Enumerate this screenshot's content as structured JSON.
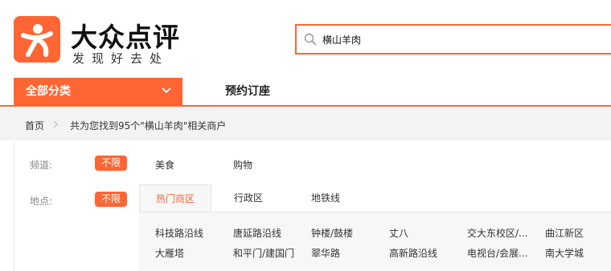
{
  "brand": {
    "name": "大众点评",
    "slogan": "发现好去处",
    "accent": "#ff6633"
  },
  "search": {
    "value": "横山羊肉",
    "icon": "search-icon"
  },
  "nav": {
    "all_categories": "全部分类",
    "chevron_icon": "chevron-down-icon",
    "reserve": "预约订座"
  },
  "breadcrumb": {
    "home": "首页",
    "result_text": "共为您找到95个\"横山羊肉\"相关商户"
  },
  "filters": {
    "channel": {
      "label": "频道:",
      "unlimited": "不限",
      "options": [
        "美食",
        "购物"
      ]
    },
    "location": {
      "label": "地点:",
      "unlimited": "不限",
      "tabs": [
        "热门商区",
        "行政区",
        "地铁线"
      ],
      "areas_row1": [
        "科技路沿线",
        "唐延路沿线",
        "钟楼/鼓楼",
        "丈八",
        "交大东校区/...",
        "曲江新区"
      ],
      "areas_row2": [
        "大雁塔",
        "和平门/建国门",
        "翠华路",
        "高新路沿线",
        "电视台/会展...",
        "南大学城"
      ]
    }
  }
}
